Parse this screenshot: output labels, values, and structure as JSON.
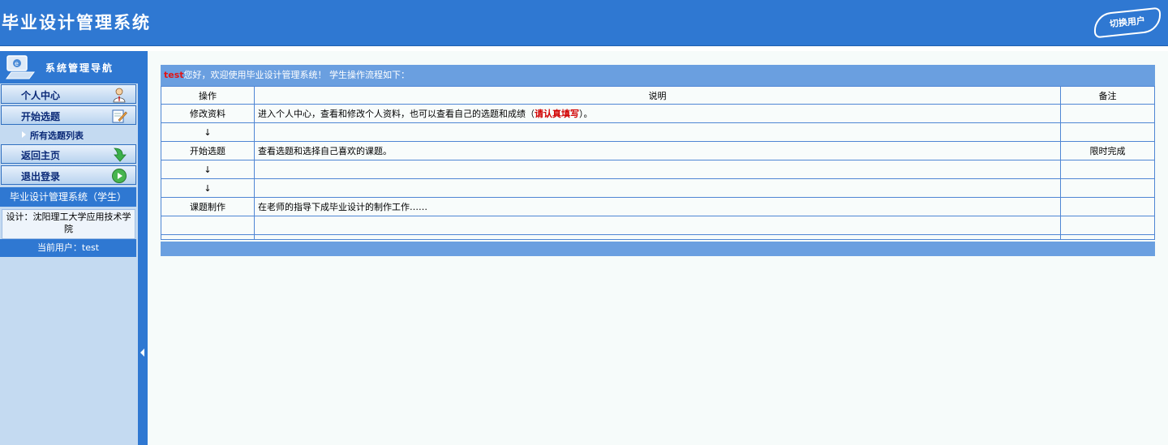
{
  "header": {
    "title": "毕业设计管理系统",
    "switch_user": "切换用户"
  },
  "sidebar": {
    "nav_title": "系统管理导航",
    "menu": [
      {
        "label": "个人中心",
        "icon": "user-icon"
      },
      {
        "label": "开始选题",
        "icon": "edit-icon"
      },
      {
        "label": "返回主页",
        "icon": "green-down-arrow-icon"
      },
      {
        "label": "退出登录",
        "icon": "green-play-icon"
      }
    ],
    "submenu": {
      "label": "所有选题列表"
    },
    "system_name": "毕业设计管理系统（学生）",
    "design": "设计：沈阳理工大学应用技术学院",
    "current_user": "当前用户：test"
  },
  "main": {
    "welcome_user": "test",
    "welcome_text": "您好，欢迎使用毕业设计管理系统！  学生操作流程如下：",
    "columns": [
      "操作",
      "说明",
      "备注"
    ],
    "rows": [
      {
        "op": "修改资料",
        "desc": "进入个人中心，查看和修改个人资料，也可以查看自己的选题和成绩（",
        "desc_important": "请认真填写",
        "desc_end": "）。",
        "note": ""
      },
      {
        "op": "↓",
        "desc": "",
        "note": ""
      },
      {
        "op": "开始选题",
        "desc": "查看选题和选择自己喜欢的课题。",
        "note": "限时完成"
      },
      {
        "op": "↓",
        "desc": "",
        "note": ""
      },
      {
        "op": "↓",
        "desc": "",
        "note": ""
      },
      {
        "op": "课题制作",
        "desc": "在老师的指导下成毕业设计的制作工作……",
        "note": ""
      },
      {
        "op": "",
        "desc": "",
        "note": ""
      }
    ]
  },
  "colors": {
    "header_blue": "#2f78d2",
    "table_header_blue": "#6a9fe0",
    "sidebar_bg": "#c4daf1",
    "important_red": "#d10000"
  }
}
